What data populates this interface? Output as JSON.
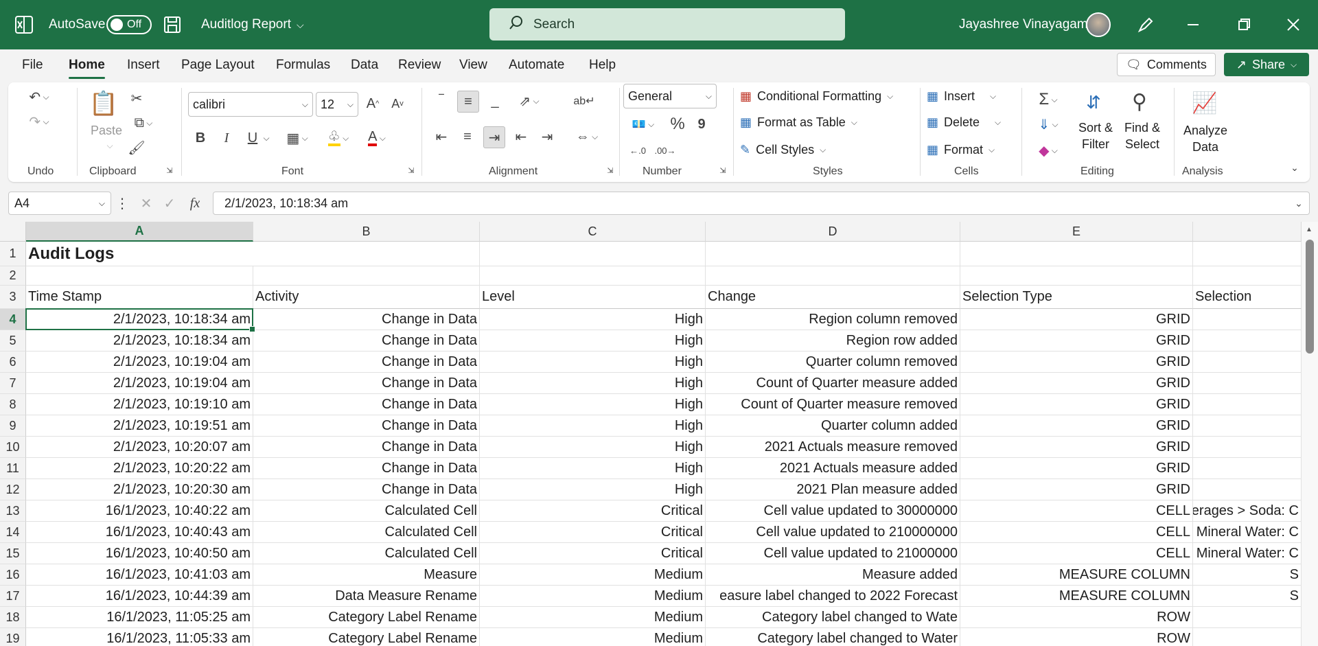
{
  "titlebar": {
    "autosave_label": "AutoSave",
    "autosave_state": "Off",
    "file_name": "Auditlog Report",
    "search_placeholder": "Search",
    "user_name": "Jayashree Vinayagam",
    "brand_color": "#1e7145"
  },
  "menu": {
    "tabs": [
      "File",
      "Home",
      "Insert",
      "Page Layout",
      "Formulas",
      "Data",
      "Review",
      "View",
      "Automate",
      "Help"
    ],
    "active_tab": "Home",
    "comments_label": "Comments",
    "share_label": "Share"
  },
  "ribbon": {
    "undo": {
      "label": "Undo"
    },
    "clipboard": {
      "label": "Clipboard",
      "paste_label": "Paste"
    },
    "font": {
      "label": "Font",
      "font_name": "calibri",
      "font_size": "12",
      "bold": "B",
      "italic": "I",
      "underline": "U"
    },
    "alignment": {
      "label": "Alignment"
    },
    "number": {
      "label": "Number",
      "format": "General",
      "percent": "%",
      "comma": "9"
    },
    "styles": {
      "label": "Styles",
      "conditional_formatting": "Conditional Formatting",
      "format_as_table": "Format as Table",
      "cell_styles": "Cell Styles"
    },
    "cells": {
      "label": "Cells",
      "insert": "Insert",
      "delete": "Delete",
      "format": "Format"
    },
    "editing": {
      "label": "Editing",
      "sort_filter_line1": "Sort &",
      "sort_filter_line2": "Filter",
      "find_select_line1": "Find &",
      "find_select_line2": "Select"
    },
    "analysis": {
      "label": "Analysis",
      "analyze_line1": "Analyze",
      "analyze_line2": "Data"
    }
  },
  "formula_bar": {
    "name_box": "A4",
    "fx": "fx",
    "value": "2/1/2023, 10:18:34 am"
  },
  "sheet": {
    "columns": [
      "A",
      "B",
      "C",
      "D",
      "E"
    ],
    "title": "Audit Logs",
    "headers": [
      "Time Stamp",
      "Activity",
      "Level",
      "Change",
      "Selection Type",
      "Selection"
    ],
    "rows": [
      {
        "n": "4",
        "cells": [
          "2/1/2023, 10:18:34 am",
          "Change in Data",
          "High",
          "Region column  removed",
          "GRID",
          ""
        ]
      },
      {
        "n": "5",
        "cells": [
          "2/1/2023, 10:18:34 am",
          "Change in Data",
          "High",
          "Region row  added",
          "GRID",
          ""
        ]
      },
      {
        "n": "6",
        "cells": [
          "2/1/2023, 10:19:04 am",
          "Change in Data",
          "High",
          "Quarter column  removed",
          "GRID",
          ""
        ]
      },
      {
        "n": "7",
        "cells": [
          "2/1/2023, 10:19:04 am",
          "Change in Data",
          "High",
          "Count of Quarter measure  added",
          "GRID",
          ""
        ]
      },
      {
        "n": "8",
        "cells": [
          "2/1/2023, 10:19:10 am",
          "Change in Data",
          "High",
          "Count of Quarter measure  removed",
          "GRID",
          ""
        ]
      },
      {
        "n": "9",
        "cells": [
          "2/1/2023, 10:19:51 am",
          "Change in Data",
          "High",
          "Quarter column  added",
          "GRID",
          ""
        ]
      },
      {
        "n": "10",
        "cells": [
          "2/1/2023, 10:20:07 am",
          "Change in Data",
          "High",
          "2021 Actuals measure  removed",
          "GRID",
          ""
        ]
      },
      {
        "n": "11",
        "cells": [
          "2/1/2023, 10:20:22 am",
          "Change in Data",
          "High",
          "2021 Actuals measure  added",
          "GRID",
          ""
        ]
      },
      {
        "n": "12",
        "cells": [
          "2/1/2023, 10:20:30 am",
          "Change in Data",
          "High",
          "2021 Plan measure  added",
          "GRID",
          ""
        ]
      },
      {
        "n": "13",
        "cells": [
          "16/1/2023, 10:40:22 am",
          "Calculated Cell",
          "Critical",
          "Cell value updated to 30000000",
          "CELL",
          "verages > Soda: C"
        ]
      },
      {
        "n": "14",
        "cells": [
          "16/1/2023, 10:40:43 am",
          "Calculated Cell",
          "Critical",
          "Cell value updated to 210000000",
          "CELL",
          "Mineral Water: C"
        ]
      },
      {
        "n": "15",
        "cells": [
          "16/1/2023, 10:40:50 am",
          "Calculated Cell",
          "Critical",
          "Cell value updated to 21000000",
          "CELL",
          "Mineral Water: C"
        ]
      },
      {
        "n": "16",
        "cells": [
          "16/1/2023, 10:41:03 am",
          "Measure",
          "Medium",
          "Measure added",
          "MEASURE COLUMN",
          "S"
        ]
      },
      {
        "n": "17",
        "cells": [
          "16/1/2023, 10:44:39 am",
          "Data Measure Rename",
          "Medium",
          "easure label changed to 2022 Forecast",
          "MEASURE COLUMN",
          "S"
        ]
      },
      {
        "n": "18",
        "cells": [
          "16/1/2023, 11:05:25 am",
          "Category Label Rename",
          "Medium",
          "Category label changed to Wate",
          "ROW",
          ""
        ]
      },
      {
        "n": "19",
        "cells": [
          "16/1/2023, 11:05:33 am",
          "Category Label Rename",
          "Medium",
          "Category label changed to Water",
          "ROW",
          ""
        ]
      }
    ]
  }
}
